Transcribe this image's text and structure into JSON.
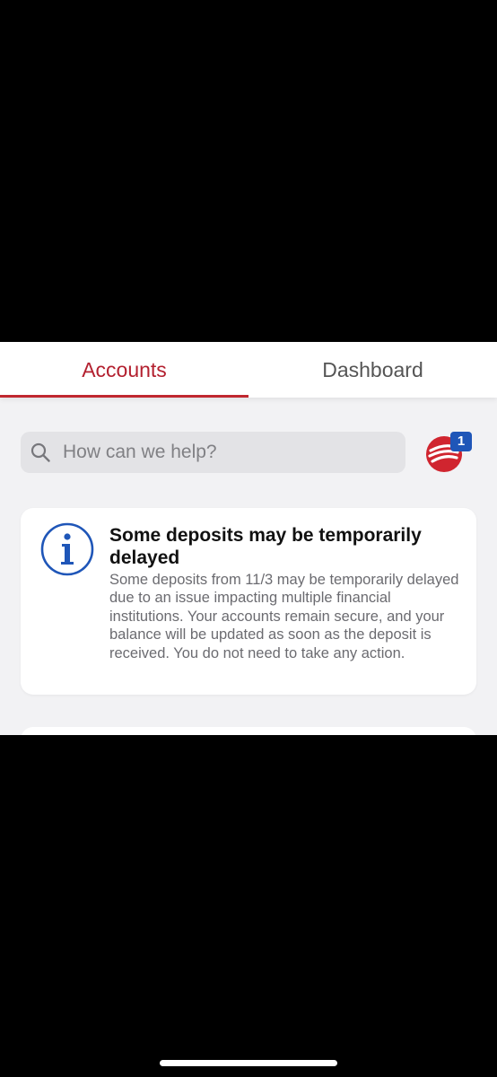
{
  "tabs": {
    "accounts": "Accounts",
    "dashboard": "Dashboard",
    "active": "accounts"
  },
  "search": {
    "placeholder": "How can we help?"
  },
  "notifications": {
    "badge_count": "1"
  },
  "alert": {
    "icon": "info-icon",
    "title": "Some deposits may be temporarily delayed",
    "body": "Some deposits from 11/3 may be temporarily delayed due to an issue impacting multiple financial institutions. Your accounts remain secure, and your balance will be updated as soon as the deposit is received. You do not need to take any action."
  },
  "colors": {
    "brand_red": "#c0282f",
    "info_blue": "#1f56b8",
    "badge_blue": "#1f56b8",
    "background": "#f2f2f4"
  }
}
